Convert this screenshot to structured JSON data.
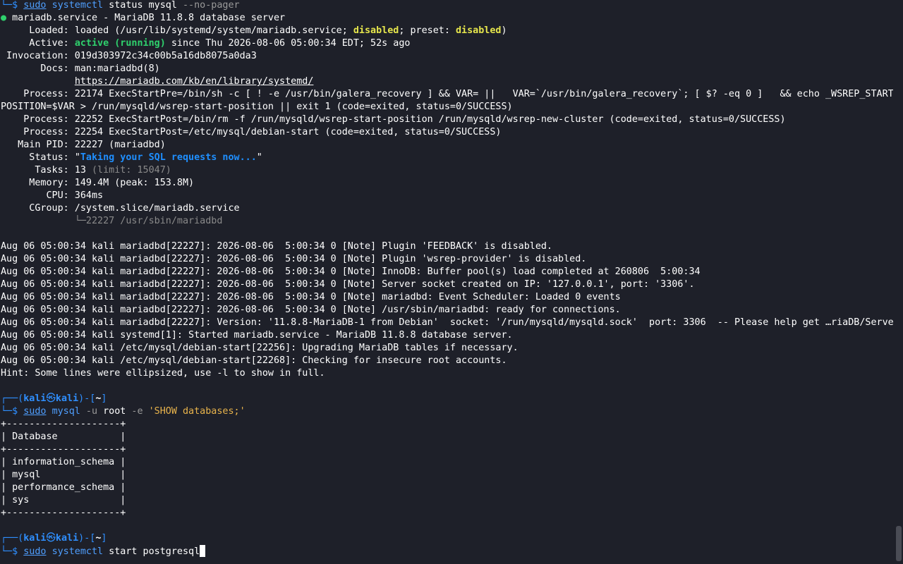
{
  "terminal": {
    "prompt": {
      "corner": "└─",
      "dollar": "$ ",
      "header_prefix": "┌──(",
      "user": "kali",
      "at": "㉿",
      "host": "kali",
      "mid": ")-[",
      "dir": "~",
      "end": "]"
    },
    "cmd1": {
      "sudo": "sudo",
      "prog": "systemctl",
      "args": " status mysql ",
      "flag": "--no-pager"
    },
    "status": {
      "bullet": "●",
      "unit_line": " mariadb.service - MariaDB 11.8.8 database server",
      "loaded_label": "     Loaded: ",
      "loaded_pre": "loaded (/usr/lib/systemd/system/mariadb.service; ",
      "loaded_disabled": "disabled",
      "loaded_mid": "; preset: ",
      "loaded_preset": "disabled",
      "loaded_end": ")",
      "active_label": "     Active: ",
      "active_state": "active (running)",
      "active_rest": " since Thu 2026-08-06 05:00:34 EDT; 52s ago",
      "invocation_line": " Invocation: 019d303972c34c00b5a16db8075a0da3",
      "docs_line": "       Docs: man:mariadbd(8)",
      "docs_indent": "             ",
      "docs_url": "https://mariadb.com/kb/en/library/systemd/",
      "process1a": "    Process: 22174 ExecStartPre=/bin/sh -c [ ! -e /usr/bin/galera_recovery ] && VAR= ||   VAR=`/usr/bin/galera_recovery`; [ $? -eq 0 ]   && echo _WSREP_START_",
      "process1b": "POSITION=$VAR > /run/mysqld/wsrep-start-position || exit 1 (code=exited, status=0/SUCCESS)",
      "process2": "    Process: 22252 ExecStartPost=/bin/rm -f /run/mysqld/wsrep-start-position /run/mysqld/wsrep-new-cluster (code=exited, status=0/SUCCESS)",
      "process3": "    Process: 22254 ExecStartPost=/etc/mysql/debian-start (code=exited, status=0/SUCCESS)",
      "mainpid_line": "   Main PID: 22227 (mariadbd)",
      "status_label": "     Status: ",
      "status_quote": "\"",
      "status_value": "Taking your SQL requests now...",
      "tasks_label": "      Tasks: ",
      "tasks_value": "13",
      "tasks_limit": " (limit: 15047)",
      "memory_line": "     Memory: 149.4M (peak: 153.8M)",
      "cpu_line": "        CPU: 364ms",
      "cgroup_line": "     CGroup: /system.slice/mariadb.service",
      "cgroup_indent": "             ",
      "cgroup_child": "└─22227 /usr/sbin/mariadbd"
    },
    "logs": [
      "Aug 06 05:00:34 kali mariadbd[22227]: 2026-08-06  5:00:34 0 [Note] Plugin 'FEEDBACK' is disabled.",
      "Aug 06 05:00:34 kali mariadbd[22227]: 2026-08-06  5:00:34 0 [Note] Plugin 'wsrep-provider' is disabled.",
      "Aug 06 05:00:34 kali mariadbd[22227]: 2026-08-06  5:00:34 0 [Note] InnoDB: Buffer pool(s) load completed at 260806  5:00:34",
      "Aug 06 05:00:34 kali mariadbd[22227]: 2026-08-06  5:00:34 0 [Note] Server socket created on IP: '127.0.0.1', port: '3306'.",
      "Aug 06 05:00:34 kali mariadbd[22227]: 2026-08-06  5:00:34 0 [Note] mariadbd: Event Scheduler: Loaded 0 events",
      "Aug 06 05:00:34 kali mariadbd[22227]: 2026-08-06  5:00:34 0 [Note] /usr/sbin/mariadbd: ready for connections.",
      "Aug 06 05:00:34 kali mariadbd[22227]: Version: '11.8.8-MariaDB-1 from Debian'  socket: '/run/mysqld/mysqld.sock'  port: 3306  -- Please help get …riaDB/Server",
      "Aug 06 05:00:34 kali systemd[1]: Started mariadb.service - MariaDB 11.8.8 database server.",
      "Aug 06 05:00:34 kali /etc/mysql/debian-start[22256]: Upgrading MariaDB tables if necessary.",
      "Aug 06 05:00:34 kali /etc/mysql/debian-start[22268]: Checking for insecure root accounts."
    ],
    "hint": "Hint: Some lines were ellipsized, use -l to show in full.",
    "cmd2": {
      "sudo": "sudo",
      "prog": "mysql",
      "flag_u": " -u",
      "user_arg": " root",
      "flag_e": " -e",
      "query": " 'SHOW databases;'"
    },
    "db_table": {
      "border": "+--------------------+",
      "header": "| Database           |",
      "rows": [
        "| information_schema |",
        "| mysql              |",
        "| performance_schema |",
        "| sys                |"
      ]
    },
    "cmd3": {
      "sudo": "sudo",
      "prog": "systemctl",
      "args": " start postgresql"
    }
  }
}
